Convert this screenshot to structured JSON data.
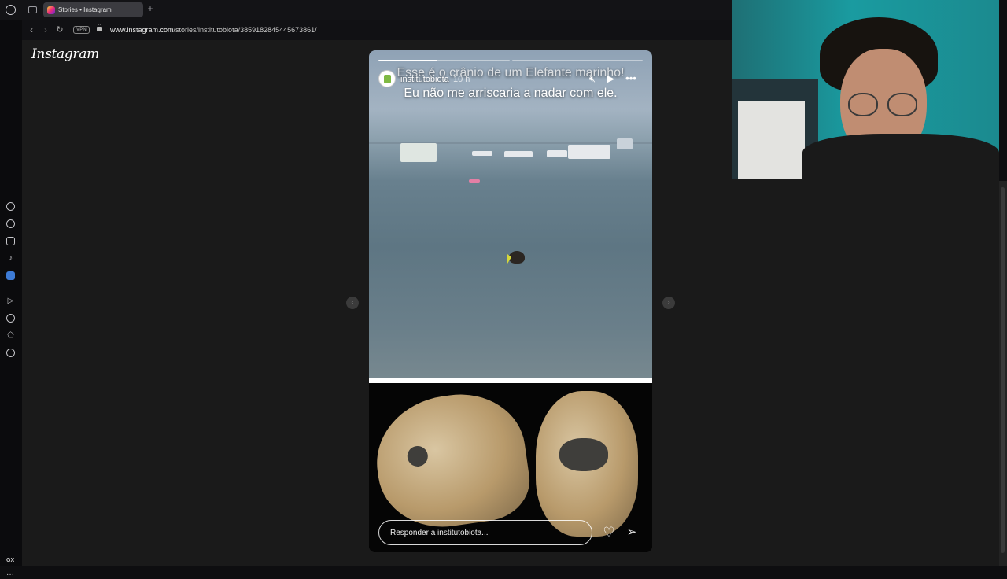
{
  "browser": {
    "tab_title": "Stories • Instagram",
    "new_tab": "+",
    "vpn_label": "VPN",
    "url_host": "www.instagram.com",
    "url_path": "/stories/institutobiota/3859182845445673861/",
    "sidebar_bottom_label": "GX",
    "sidebar_more": "···"
  },
  "page": {
    "logo_text": "Instagram"
  },
  "story": {
    "progress_segments": 2,
    "progress_fraction_first": 0.45,
    "username": "institutobiota",
    "time_ago": "10 h",
    "caption_line_1": "Esse é o crânio de um Elefante marinho!",
    "caption_line_2": "Eu não me arriscaria a nadar com ele.",
    "reply_placeholder": "Responder a institutobiota...",
    "icons": {
      "mute": "speaker-icon",
      "play": "play-icon",
      "more": "more-icon",
      "like": "heart-icon",
      "share": "send-icon"
    }
  },
  "colors": {
    "page_bg": "#1a1a1a",
    "story_bg": "#000000",
    "text": "#ffffff"
  }
}
